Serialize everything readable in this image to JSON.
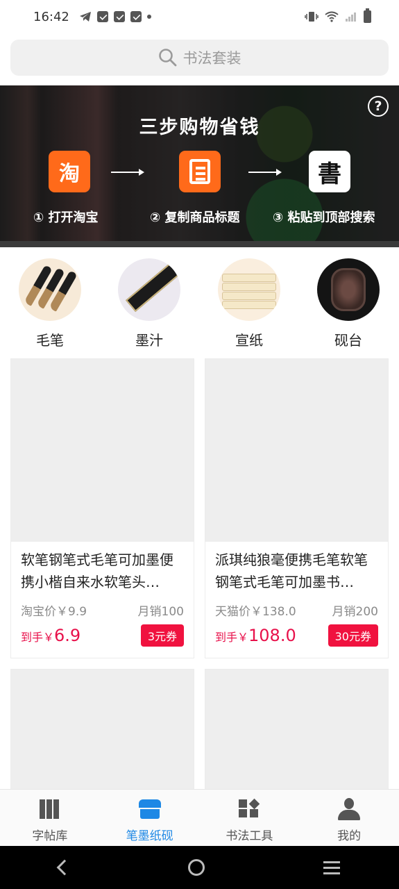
{
  "status_bar": {
    "time": "16:42"
  },
  "search": {
    "placeholder": "书法套装"
  },
  "banner": {
    "title": "三步购物省钱",
    "help_symbol": "?",
    "steps": [
      {
        "label": "① 打开淘宝",
        "icon": "taobao-icon",
        "icon_text": "淘"
      },
      {
        "label": "② 复制商品标题",
        "icon": "copy-document-icon"
      },
      {
        "label": "③ 粘贴到顶部搜索",
        "icon": "calligraphy-app-icon",
        "icon_text": "書"
      }
    ]
  },
  "categories": [
    {
      "label": "毛笔",
      "icon": "brush-image"
    },
    {
      "label": "墨汁",
      "icon": "ink-image"
    },
    {
      "label": "宣纸",
      "icon": "rice-paper-image"
    },
    {
      "label": "砚台",
      "icon": "inkstone-image"
    }
  ],
  "products": [
    {
      "title": "软笔钢笔式毛笔可加墨便携小楷自来水软笔头…",
      "platform_price": "淘宝价￥9.9",
      "monthly_sales": "月销100",
      "final_price_prefix": "到手￥",
      "final_price": "6.9",
      "coupon": "3元券"
    },
    {
      "title": "派琪纯狼毫便携毛笔软笔钢笔式毛笔可加墨书…",
      "platform_price": "天猫价￥138.0",
      "monthly_sales": "月销200",
      "final_price_prefix": "到手￥",
      "final_price": "108.0",
      "coupon": "30元券"
    }
  ],
  "tab_bar": {
    "items": [
      {
        "label": "字帖库",
        "icon": "books-icon",
        "active": false
      },
      {
        "label": "笔墨纸砚",
        "icon": "shop-icon",
        "active": true
      },
      {
        "label": "书法工具",
        "icon": "tools-grid-icon",
        "active": false
      },
      {
        "label": "我的",
        "icon": "user-icon",
        "active": false
      }
    ]
  },
  "colors": {
    "accent": "#1e88e5",
    "price": "#e8104a",
    "coupon": "#f0123f",
    "step_icon": "#ff6a1a"
  }
}
